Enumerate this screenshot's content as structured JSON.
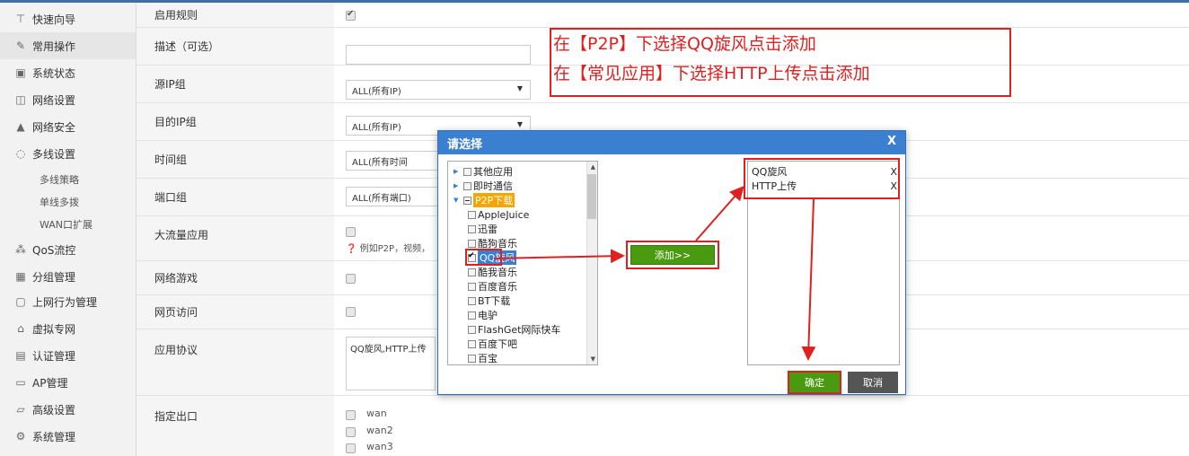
{
  "sidebar": {
    "items": [
      {
        "icon": "signpost-icon",
        "glyph": "⊤",
        "label": "快速向导"
      },
      {
        "icon": "wrench-icon",
        "glyph": "🔧",
        "label": "常用操作"
      },
      {
        "icon": "monitor-icon",
        "glyph": "▣",
        "label": "系统状态"
      },
      {
        "icon": "network-icon",
        "glyph": "◫",
        "label": "网络设置"
      },
      {
        "icon": "shield-icon",
        "glyph": "▲",
        "label": "网络安全"
      },
      {
        "icon": "multi-wan-icon",
        "glyph": "◌",
        "label": "多线设置"
      }
    ],
    "subitems": [
      "多线策略",
      "单线多拨",
      "WAN口扩展"
    ],
    "items2": [
      {
        "icon": "qos-icon",
        "glyph": "⁂",
        "label": "QoS流控"
      },
      {
        "icon": "group-icon",
        "glyph": "▦",
        "label": "分组管理"
      },
      {
        "icon": "behavior-icon",
        "glyph": "▢",
        "label": "上网行为管理"
      },
      {
        "icon": "vpn-icon",
        "glyph": "⌂",
        "label": "虚拟专网"
      },
      {
        "icon": "auth-icon",
        "glyph": "▤",
        "label": "认证管理"
      },
      {
        "icon": "ap-icon",
        "glyph": "▭",
        "label": "AP管理"
      },
      {
        "icon": "advanced-icon",
        "glyph": "▱",
        "label": "高级设置"
      },
      {
        "icon": "gear-icon",
        "glyph": "⚙",
        "label": "系统管理"
      }
    ]
  },
  "form": {
    "enable_rule": "启用规则",
    "description": "描述（可选）",
    "src_ip_group": "源IP组",
    "src_ip_value": "ALL(所有IP)",
    "dst_ip_group": "目的IP组",
    "dst_ip_value": "ALL(所有IP)",
    "time_group": "时间组",
    "time_value": "ALL(所有时间",
    "port_group": "端口组",
    "port_value": "ALL(所有端口)",
    "big_flow": "大流量应用",
    "big_flow_hint": "例如P2P，视频，",
    "game": "网络游戏",
    "web": "网页访问",
    "app_protocol": "应用协议",
    "app_protocol_value": "QQ旋风,HTTP上传",
    "exit": "指定出口",
    "exits": [
      "wan",
      "wan2",
      "wan3"
    ]
  },
  "annotation": {
    "line1": "在【P2P】下选择QQ旋风点击添加",
    "line2": "在【常见应用】下选择HTTP上传点击添加"
  },
  "dialog": {
    "title": "请选择",
    "close": "X",
    "tree": [
      {
        "label": "其他应用",
        "level": 0,
        "twisty": "▸"
      },
      {
        "label": "即时通信",
        "level": 0,
        "twisty": "▸"
      },
      {
        "label": "P2P下载",
        "level": 0,
        "twisty": "▾"
      },
      {
        "label": "AppleJuice",
        "level": 1
      },
      {
        "label": "迅雷",
        "level": 1
      },
      {
        "label": "酷狗音乐",
        "level": 1
      },
      {
        "label": "QQ旋风",
        "level": 1,
        "checked": true
      },
      {
        "label": "酷我音乐",
        "level": 1
      },
      {
        "label": "百度音乐",
        "level": 1
      },
      {
        "label": "BT下载",
        "level": 1
      },
      {
        "label": "电驴",
        "level": 1
      },
      {
        "label": "FlashGet网际快车",
        "level": 1
      },
      {
        "label": "百度下吧",
        "level": 1
      },
      {
        "label": "百宝",
        "level": 1
      }
    ],
    "add_button": "添加>>",
    "selected": [
      {
        "label": "QQ旋风",
        "remove": "X"
      },
      {
        "label": "HTTP上传",
        "remove": "X"
      }
    ],
    "ok": "确定",
    "cancel": "取消"
  },
  "colors": {
    "accent": "#3b7fd0",
    "highlight": "#e02020",
    "green": "#4a9a10"
  }
}
